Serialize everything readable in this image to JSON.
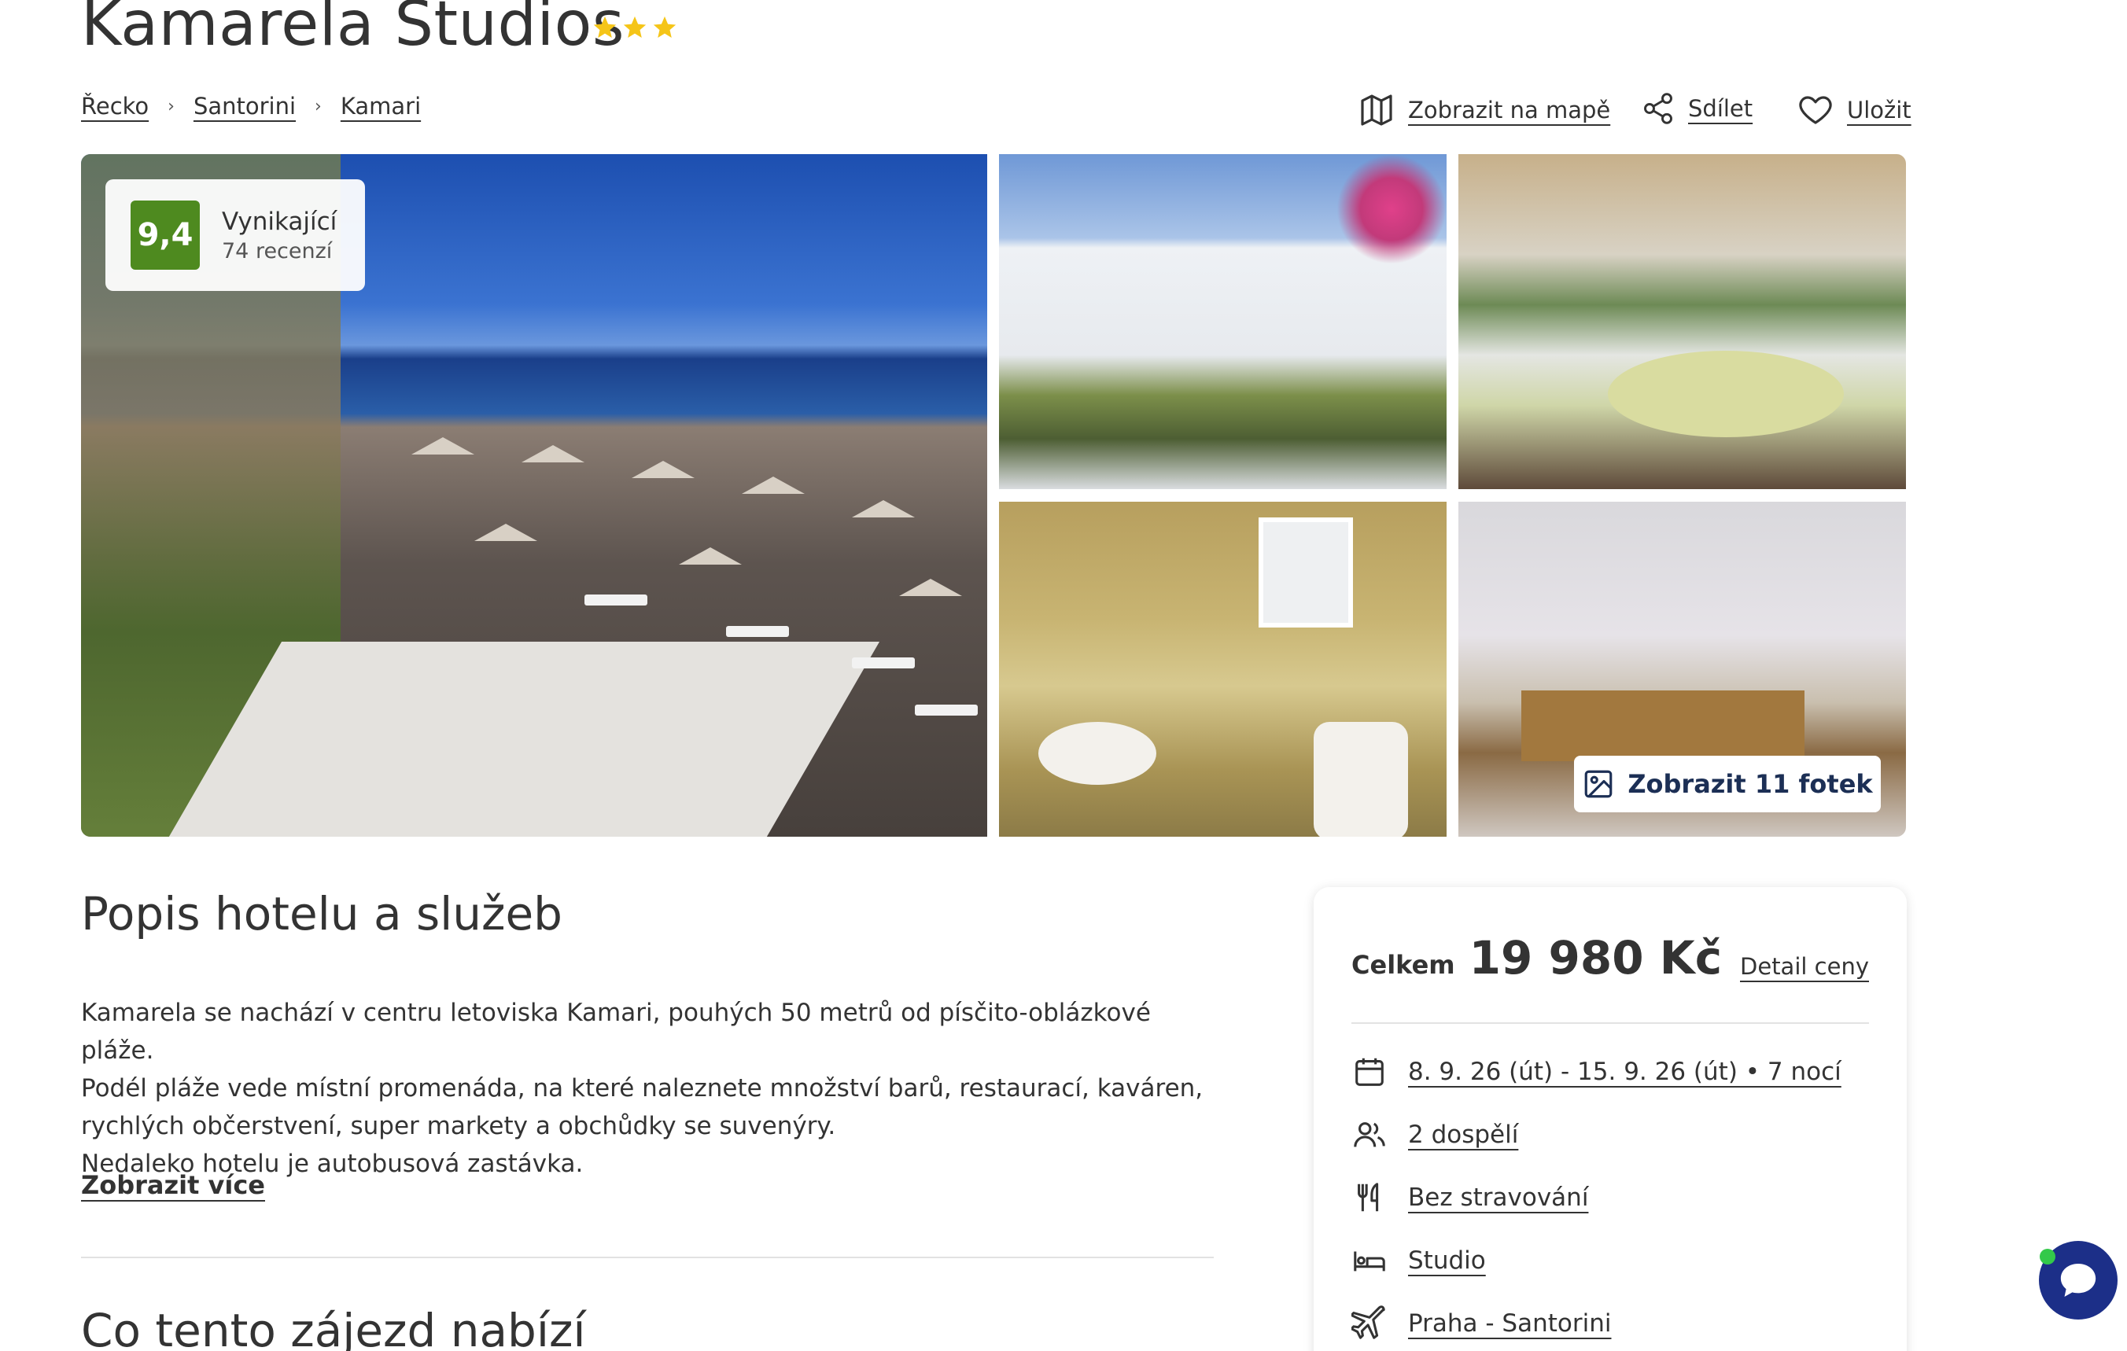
{
  "hotel": {
    "name": "Kamarela Studios",
    "stars": 3,
    "star_color": "#f5c518"
  },
  "breadcrumb": [
    "Řecko",
    "Santorini",
    "Kamari"
  ],
  "actions": {
    "map": "Zobrazit na mapě",
    "share": "Sdílet",
    "save": "Uložit"
  },
  "rating": {
    "score": "9,4",
    "label": "Vynikající",
    "reviews": "74 recenzí",
    "color": "#4e8a1f"
  },
  "gallery": {
    "show_photos_label": "Zobrazit 11 fotek",
    "photos": [
      "beach-photo",
      "hotel-exterior-photo",
      "terrace-photo",
      "bathroom-photo",
      "bedroom-photo"
    ]
  },
  "description": {
    "title": "Popis hotelu a služeb",
    "text": "Kamarela se nachází v centru letoviska Kamari, pouhých 50 metrů od písčito-oblázkové pláže.\nPodél pláže vede místní promenáda, na které naleznete množství barů, restaurací, kaváren,\nrychlých občerstvení, super markety a obchůdky se suvenýry.\nNedaleko hotelu je autobusová zastávka.",
    "show_more": "Zobrazit více",
    "offer_title": "Co tento zájezd nabízí"
  },
  "price_card": {
    "total_label": "Celkem",
    "total_value": "19 980 Kč",
    "detail_link": "Detail ceny",
    "rows": [
      {
        "icon": "calendar-icon",
        "text": "8. 9. 26 (út) - 15. 9. 26 (út) • 7 nocí"
      },
      {
        "icon": "people-icon",
        "text": "2 dospělí"
      },
      {
        "icon": "cutlery-icon",
        "text": "Bez stravování"
      },
      {
        "icon": "bed-icon",
        "text": "Studio"
      },
      {
        "icon": "plane-icon",
        "text": "Praha - Santorini"
      }
    ]
  },
  "chat": {
    "accent": "#1c2f88",
    "online_color": "#33c94a"
  }
}
